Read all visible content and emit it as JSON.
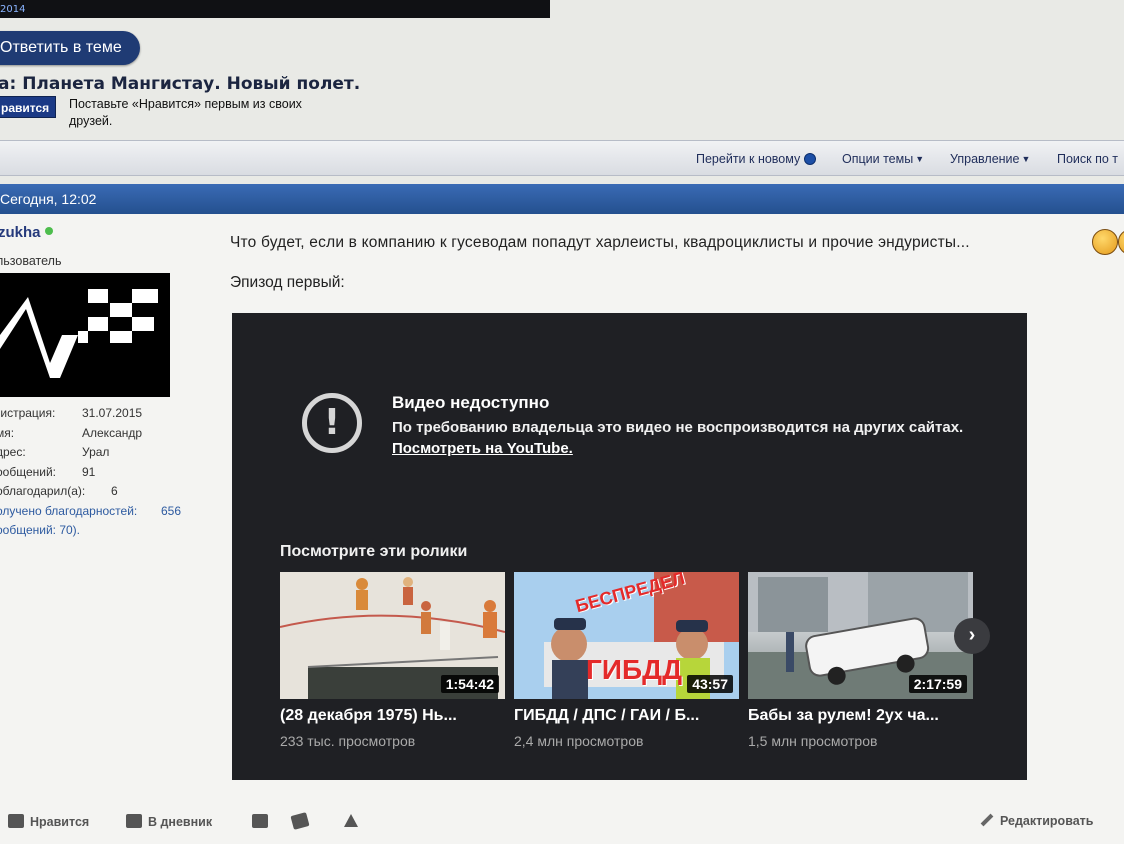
{
  "header": {
    "top_badge": "2014"
  },
  "reply_button": "Ответить в теме",
  "thread": {
    "title": "а: Планета Мангистау. Новый полет.",
    "like_button": "равится",
    "like_prompt": "Поставьте «Нравится» первым из своих друзей."
  },
  "toolbar": {
    "go_new": "Перейти к новому",
    "thread_options": "Опции темы",
    "manage": "Управление",
    "search": "Поиск по т"
  },
  "post": {
    "date": "Сегодня, 12:02",
    "user": {
      "name": "zukha",
      "rank": "льзователь",
      "stats": [
        {
          "k": "гистрация:",
          "v": "31.07.2015"
        },
        {
          "k": "мя:",
          "v": "Александр"
        },
        {
          "k": "дрес:",
          "v": "Урал"
        },
        {
          "k": "ообщений:",
          "v": "91"
        },
        {
          "k": "облагодарил(а):",
          "v": "6"
        },
        {
          "k": "олучено благодарностей:",
          "v": "656"
        },
        {
          "k": "ообщений: 70).",
          "v": ""
        }
      ]
    },
    "message": "Что будет, если в компанию к гусеводам попадут харлеисты, квадроциклисты и прочие эндуристы...",
    "message2": "Эпизод первый:"
  },
  "video": {
    "unavailable_title": "Видео недоступно",
    "unavailable_desc": "По требованию владельца это видео не воспроизводится на других сайтах.",
    "watch_link": "Посмотреть на YouTube.",
    "suggest_heading": "Посмотрите эти ролики",
    "items": [
      {
        "title": "(28 декабря 1975) Нь...",
        "views": "233 тыс. просмотров",
        "duration": "1:54:42"
      },
      {
        "title": "ГИБДД / ДПС / ГАИ / Б...",
        "views": "2,4 млн просмотров",
        "duration": "43:57",
        "overlay_top": "БЕСПРЕДЕЛ",
        "overlay_bottom": "ГИБДД"
      },
      {
        "title": "Бабы за рулем! 2ух ча...",
        "views": "1,5 млн просмотров",
        "duration": "2:17:59"
      }
    ]
  },
  "bottom": {
    "like": "Нравится",
    "diary": "В дневник",
    "edit": "Редактировать"
  },
  "colors": {
    "accent": "#1f3b74",
    "header_bar": "#2f5ea3",
    "video_bg": "#1f2024"
  }
}
